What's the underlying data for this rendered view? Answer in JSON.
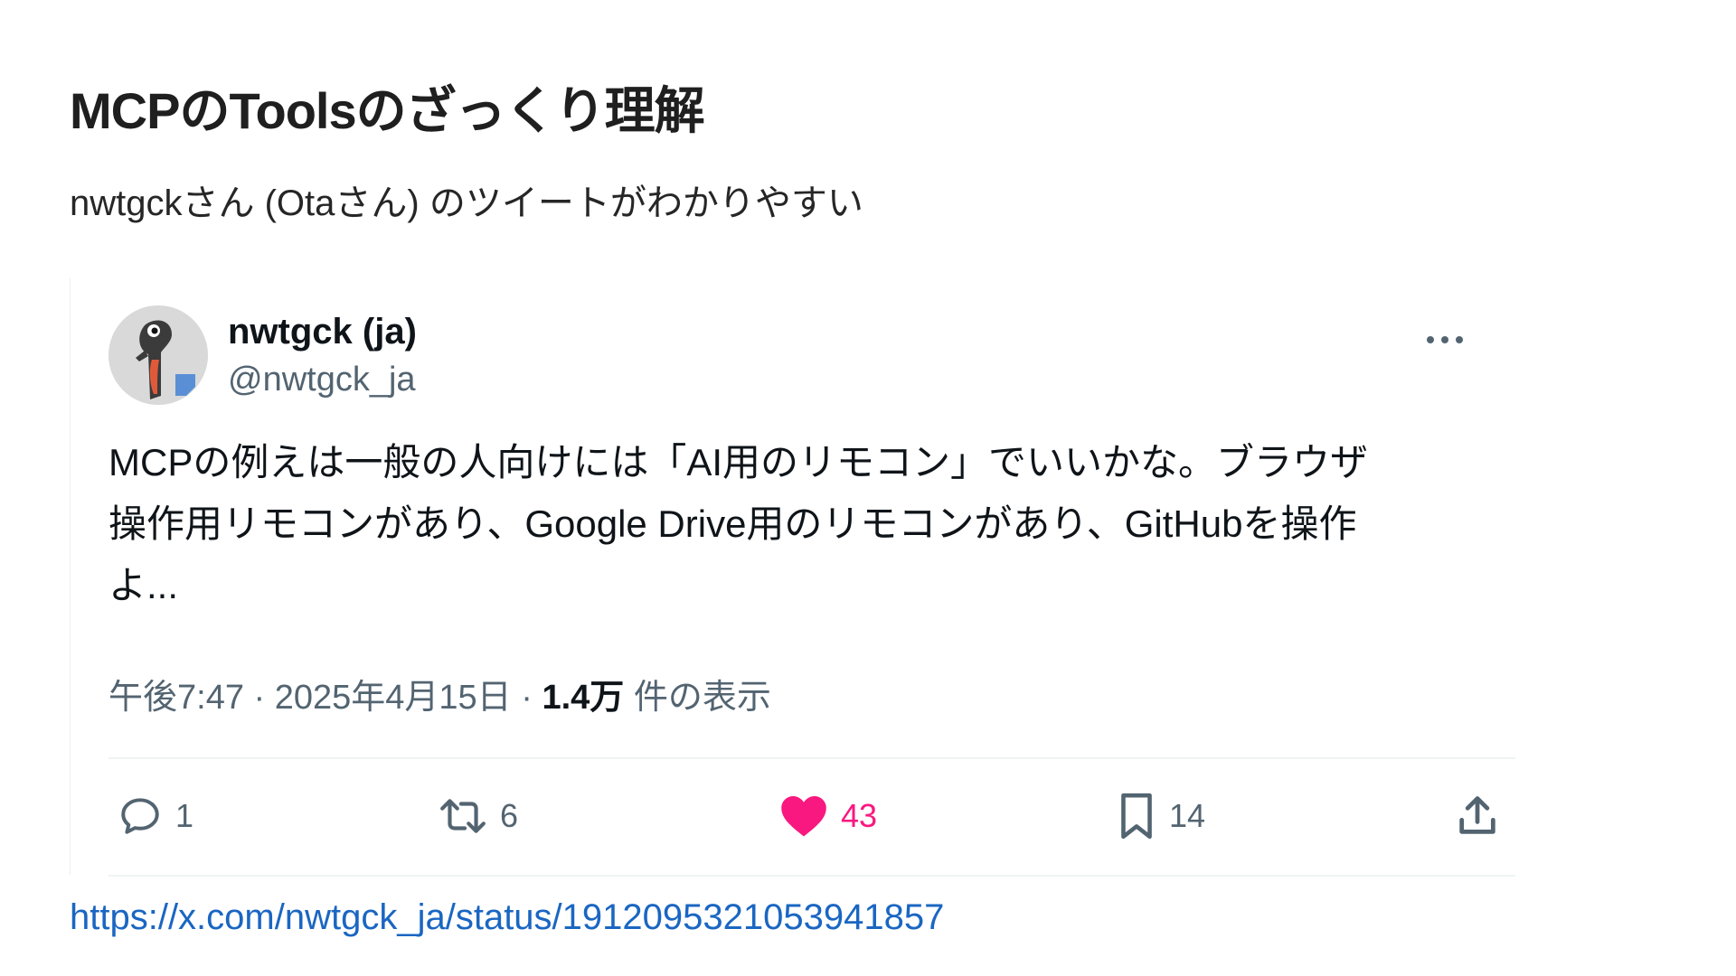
{
  "slide": {
    "title": "MCPのToolsのざっくり理解",
    "subtitle": "nwtgckさん (Otaさん) のツイートがわかりやすい",
    "link": "https://x.com/nwtgck_ja/status/1912095321053941857"
  },
  "tweet": {
    "display_name": "nwtgck (ja)",
    "handle": "@nwtgck_ja",
    "avatar_icon": "lizard-avatar-icon",
    "text": "MCPの例えは一般の人向けには「AI用のリモコン」でいいかな。ブラウザ\n操作用リモコンがあり、Google Drive用のリモコンがあり、GitHubを操作\nよ...",
    "time": "午後7:47",
    "separator": "·",
    "date": "2025年4月15日",
    "views_count": "1.4万",
    "views_label": "件の表示",
    "actions": {
      "reply_count": "1",
      "retweet_count": "6",
      "like_count": "43",
      "bookmark_count": "14"
    }
  },
  "colors": {
    "accent_link": "#1a66c2",
    "like_pink": "#f91880",
    "muted_gray": "#536471"
  }
}
